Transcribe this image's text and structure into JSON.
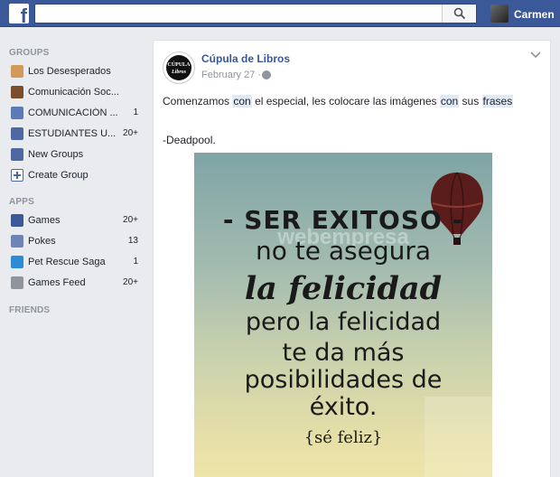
{
  "topbar": {
    "logo": "f",
    "search_placeholder": "",
    "user_name": "Carmen"
  },
  "sidebar": {
    "groups_title": "GROUPS",
    "groups": [
      {
        "label": "Los Desesperados",
        "count": "",
        "icon_color": "#d2995b"
      },
      {
        "label": "Comunicación Soc...",
        "count": "",
        "icon_color": "#7a4e2a"
      },
      {
        "label": "COMUNICACIÓN ...",
        "count": "1",
        "icon_color": "#5b7bb6"
      },
      {
        "label": "ESTUDIANTES U...",
        "count": "20+",
        "icon_color": "#4e69a2"
      },
      {
        "label": "New Groups",
        "count": "",
        "icon_color": "#4e69a2"
      },
      {
        "label": "Create Group",
        "count": "",
        "icon_color": "#4e69a2"
      }
    ],
    "apps_title": "APPS",
    "apps": [
      {
        "label": "Games",
        "count": "20+",
        "icon_color": "#3b5998"
      },
      {
        "label": "Pokes",
        "count": "13",
        "icon_color": "#6d84b4"
      },
      {
        "label": "Pet Rescue Saga",
        "count": "1",
        "icon_color": "#2e8bd6"
      },
      {
        "label": "Games Feed",
        "count": "20+",
        "icon_color": "#90949c"
      }
    ],
    "friends_title": "FRIENDS"
  },
  "post": {
    "page_name": "Cúpula de Libros",
    "avatar_text_1": "CÚPULA",
    "avatar_text_2": "Libros",
    "date": "February 27 ·",
    "text_parts": [
      "Comenzamos ",
      "con",
      " el especial, les colocare las imágenes ",
      "con",
      " sus ",
      "frases"
    ],
    "signature": "-Deadpool.",
    "image": {
      "line1": "- SER EXITOSO -",
      "line2": "no te asegura",
      "line3": "la felicidad",
      "line4": "pero la felicidad",
      "line5": "te da más",
      "line6": "posibilidades de",
      "line7": "éxito.",
      "line8": "{sé feliz}",
      "watermark": "webempresa"
    }
  }
}
